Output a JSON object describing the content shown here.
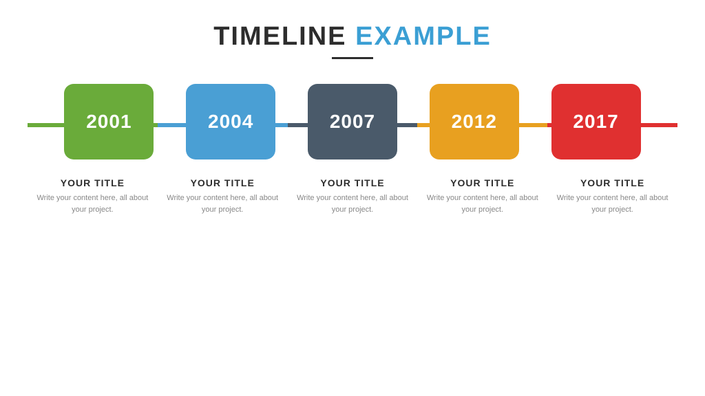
{
  "header": {
    "title_part1": "TIMELINE",
    "title_part2": "EXAMPLE"
  },
  "timeline": {
    "items": [
      {
        "year": "2001",
        "color_class": "box-green",
        "segment_class": "segment-green",
        "title": "YOUR TITLE",
        "description": "Write your content here, all about your project."
      },
      {
        "year": "2004",
        "color_class": "box-blue",
        "segment_class": "segment-blue",
        "title": "YOUR TITLE",
        "description": "Write your content here, all about your project."
      },
      {
        "year": "2007",
        "color_class": "box-dark",
        "segment_class": "segment-dark",
        "title": "YOUR TITLE",
        "description": "Write your content here, all about your project."
      },
      {
        "year": "2012",
        "color_class": "box-orange",
        "segment_class": "segment-orange",
        "title": "YOUR TITLE",
        "description": "Write your content here, all about your project."
      },
      {
        "year": "2017",
        "color_class": "box-red",
        "segment_class": "segment-red",
        "title": "YOUR TITLE",
        "description": "Write your content here, all about your project."
      }
    ]
  }
}
